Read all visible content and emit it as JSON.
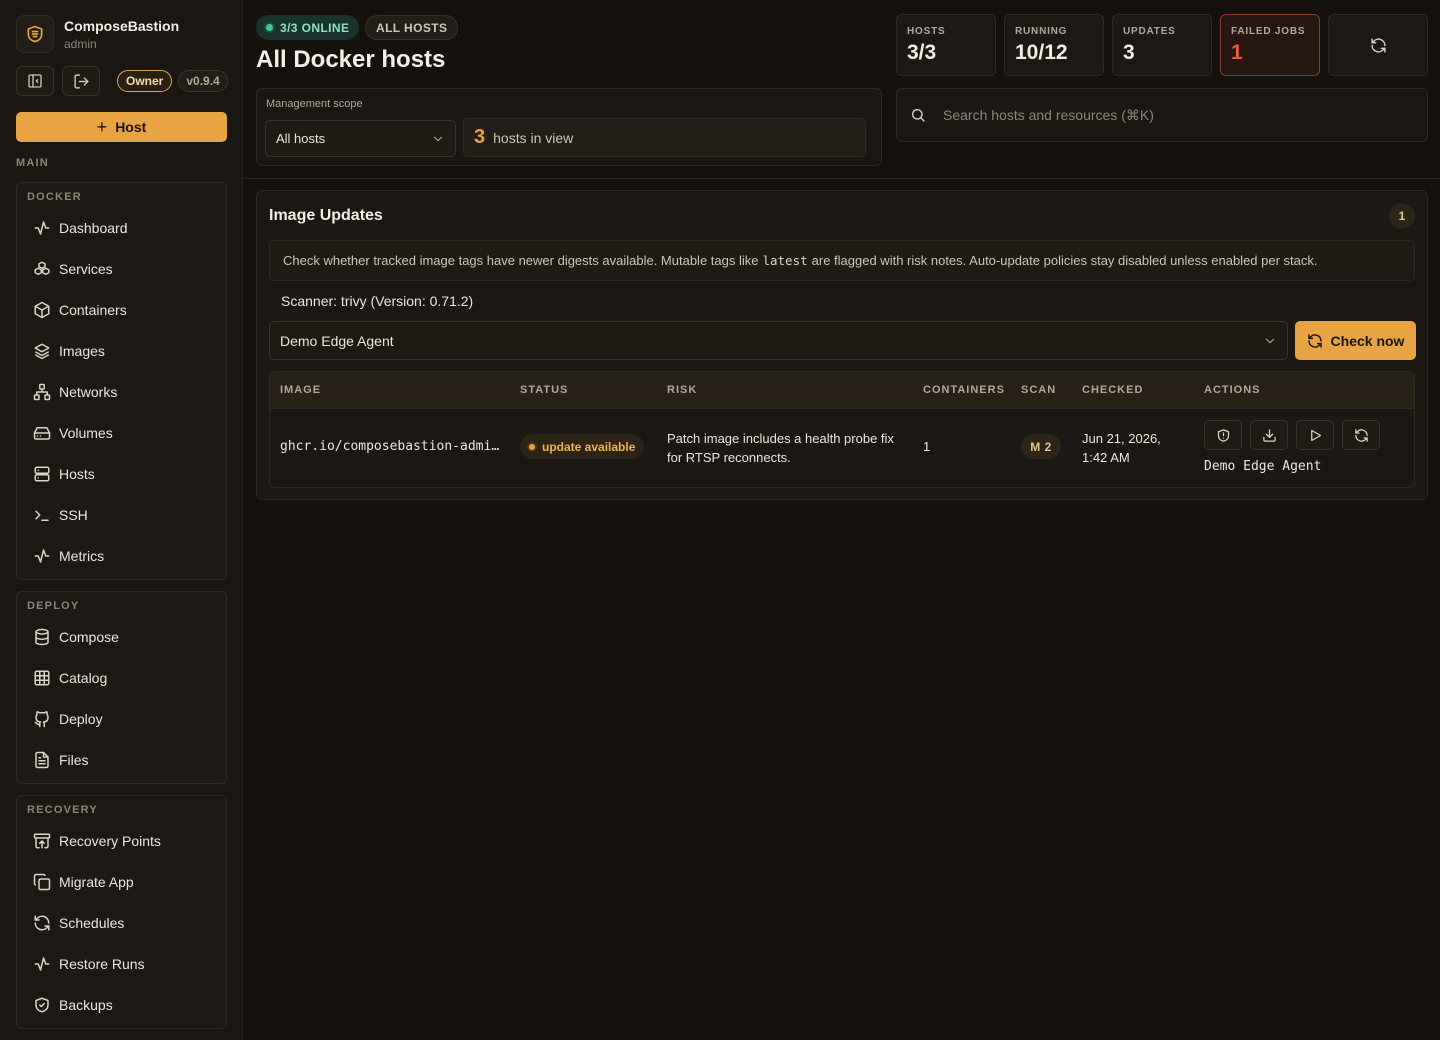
{
  "brand": {
    "name": "ComposeBastion",
    "user": "admin",
    "role": "Owner",
    "version": "v0.9.4"
  },
  "sidebar": {
    "host_button": "Host",
    "main_label": "MAIN",
    "groups": [
      {
        "title": "DOCKER",
        "items": [
          {
            "label": "Dashboard",
            "icon": "activity-icon"
          },
          {
            "label": "Services",
            "icon": "boxes-icon"
          },
          {
            "label": "Containers",
            "icon": "box-icon"
          },
          {
            "label": "Images",
            "icon": "layers-icon"
          },
          {
            "label": "Networks",
            "icon": "network-icon"
          },
          {
            "label": "Volumes",
            "icon": "hard-drive-icon"
          },
          {
            "label": "Hosts",
            "icon": "server-icon"
          },
          {
            "label": "SSH",
            "icon": "terminal-icon"
          },
          {
            "label": "Metrics",
            "icon": "activity-icon"
          }
        ]
      },
      {
        "title": "DEPLOY",
        "items": [
          {
            "label": "Compose",
            "icon": "database-icon"
          },
          {
            "label": "Catalog",
            "icon": "grid-icon"
          },
          {
            "label": "Deploy",
            "icon": "github-icon"
          },
          {
            "label": "Files",
            "icon": "file-icon"
          }
        ]
      },
      {
        "title": "RECOVERY",
        "items": [
          {
            "label": "Recovery Points",
            "icon": "archive-restore-icon"
          },
          {
            "label": "Migrate App",
            "icon": "copy-icon"
          },
          {
            "label": "Schedules",
            "icon": "refresh-icon"
          },
          {
            "label": "Restore Runs",
            "icon": "activity-icon"
          },
          {
            "label": "Backups",
            "icon": "shield-icon"
          }
        ]
      }
    ]
  },
  "header": {
    "online_pill": "3/3 ONLINE",
    "scope_pill": "ALL HOSTS",
    "title": "All Docker hosts",
    "scope_label": "Management scope",
    "scope_value": "All hosts",
    "hosts_in_view_count": "3",
    "hosts_in_view_text": "hosts in view",
    "search_placeholder": "Search hosts and resources (⌘K)",
    "stats": [
      {
        "label": "HOSTS",
        "value": "3/3"
      },
      {
        "label": "RUNNING",
        "value": "10/12"
      },
      {
        "label": "UPDATES",
        "value": "3"
      },
      {
        "label": "FAILED JOBS",
        "value": "1"
      }
    ]
  },
  "card": {
    "title": "Image Updates",
    "badge": "1",
    "info_before": "Check whether tracked image tags have newer digests available. Mutable tags like",
    "info_code": "latest",
    "info_after": "are flagged with risk notes. Auto-update policies stay disabled unless enabled per stack.",
    "scanner": "Scanner: trivy (Version: 0.71.2)",
    "agent_select": "Demo Edge Agent",
    "check_button": "Check now",
    "columns": [
      "IMAGE",
      "STATUS",
      "RISK",
      "CONTAINERS",
      "SCAN",
      "CHECKED",
      "ACTIONS"
    ],
    "rows": [
      {
        "image": "ghcr.io/composebastion-admi…",
        "status": "update available",
        "risk_line1": "Patch image includes a health probe fix",
        "risk_line2": "for RTSP reconnects.",
        "containers": "1",
        "scan": "M 2",
        "checked_line1": "Jun 21, 2026,",
        "checked_line2": "1:42 AM",
        "agent": "Demo Edge Agent"
      }
    ]
  },
  "colors": {
    "accent": "#e8a443",
    "background": "#15120e",
    "online": "#3fc79a",
    "danger": "#ee5a3c"
  }
}
